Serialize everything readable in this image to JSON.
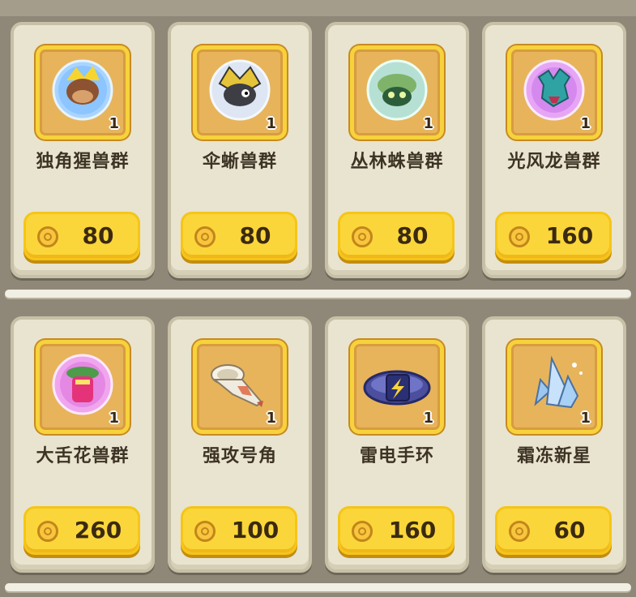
{
  "items": [
    {
      "name": "独角猩兽群",
      "qty": "1",
      "price": "80",
      "icon": "unicorn-ape-icon",
      "orb_color": "#8fc6ff"
    },
    {
      "name": "伞蜥兽群",
      "qty": "1",
      "price": "80",
      "icon": "frill-lizard-icon",
      "orb_color": "#c9d6e8"
    },
    {
      "name": "丛林蛛兽群",
      "qty": "1",
      "price": "80",
      "icon": "jungle-spider-icon",
      "orb_color": "#9ad3b4"
    },
    {
      "name": "光风龙兽群",
      "qty": "1",
      "price": "160",
      "icon": "light-wind-dragon-icon",
      "orb_color": "#d08cf0"
    },
    {
      "name": "大舌花兽群",
      "qty": "1",
      "price": "260",
      "icon": "big-tongue-flower-icon",
      "orb_color": "#e07ce0"
    },
    {
      "name": "强攻号角",
      "qty": "1",
      "price": "100",
      "icon": "attack-horn-icon",
      "orb_color": ""
    },
    {
      "name": "雷电手环",
      "qty": "1",
      "price": "160",
      "icon": "thunder-bracelet-icon",
      "orb_color": ""
    },
    {
      "name": "霜冻新星",
      "qty": "1",
      "price": "60",
      "icon": "frost-nova-crystal-icon",
      "orb_color": ""
    }
  ],
  "colors": {
    "button": "#fbd63a",
    "frame": "#f7d23c",
    "card": "#e9e4cf"
  }
}
